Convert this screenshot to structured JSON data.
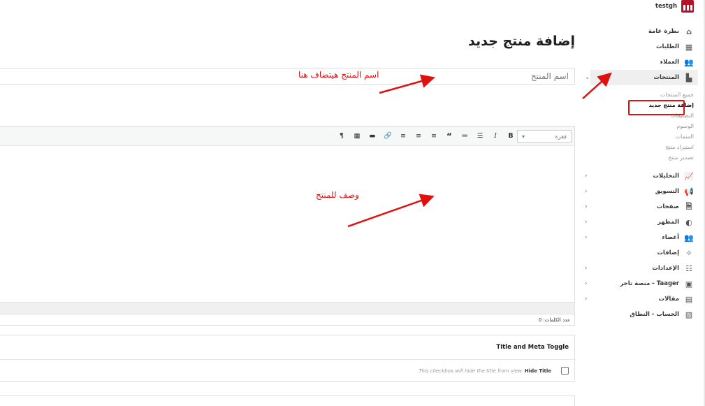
{
  "store": {
    "name": "testgh"
  },
  "page": {
    "title": "إضافة منتج جديد"
  },
  "title_field": {
    "placeholder": "اسم المنتج"
  },
  "editor": {
    "format_select": "فقرة",
    "word_count": "عدد الكلمات: 0"
  },
  "metabox": {
    "title": "Title and Meta Toggle",
    "hide_title_label": "Hide Title",
    "hide_title_hint": "This checkbox will hide the title from view"
  },
  "annotations": {
    "title_note": "اسم المنتج هيتضاف هنا",
    "desc_note": "وصف للمنتج",
    "color": "#e01010"
  },
  "sidebar": {
    "items": [
      {
        "label": "نظرة عامة",
        "icon": "store-icon"
      },
      {
        "label": "الطلبات",
        "icon": "grid-icon"
      },
      {
        "label": "العملاء",
        "icon": "users-icon"
      },
      {
        "label": "المنتجات",
        "icon": "bag-icon"
      },
      {
        "label": "التحليلات",
        "icon": "chart-icon"
      },
      {
        "label": "التسويق",
        "icon": "megaphone-icon"
      },
      {
        "label": "صفحات",
        "icon": "page-icon"
      },
      {
        "label": "المظهر",
        "icon": "palette-icon"
      },
      {
        "label": "أعضاء",
        "icon": "members-icon"
      },
      {
        "label": "إضافات",
        "icon": "plugin-icon"
      },
      {
        "label": "الإعدادات",
        "icon": "sliders-icon"
      },
      {
        "label": "Taager - منصة تاجر",
        "icon": "taager-icon"
      },
      {
        "label": "مقالات",
        "icon": "posts-icon"
      },
      {
        "label": "الحساب - النطاق",
        "icon": "account-icon"
      }
    ],
    "products_submenu": [
      "جميع المنتجات",
      "إضافة منتج جديد",
      "التصنيفات",
      "الوسوم",
      "السمات",
      "استيراد منتج",
      "تصدير منتج"
    ]
  }
}
